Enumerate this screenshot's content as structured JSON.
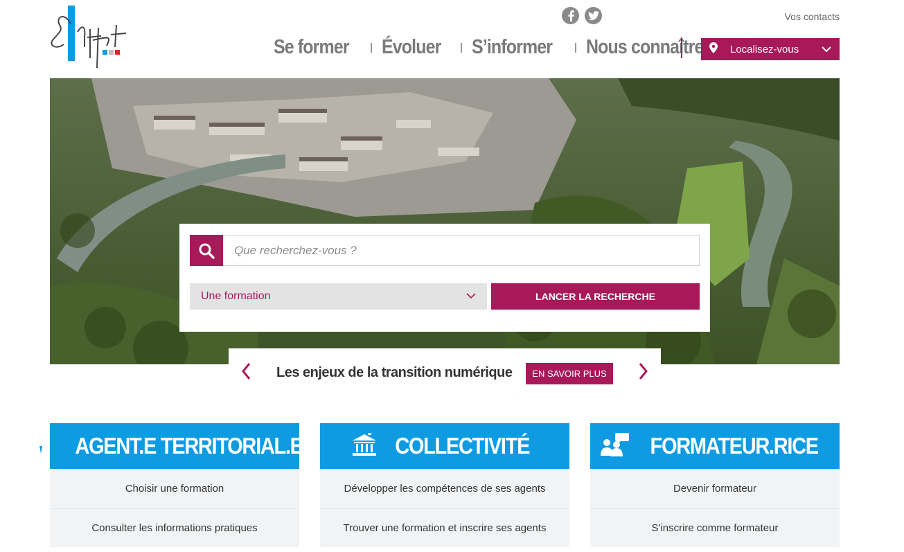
{
  "header": {
    "logo_text": "le Cnfpt",
    "contacts_label": "Vos contacts",
    "social": [
      {
        "icon": "facebook-icon",
        "glyph": "f"
      },
      {
        "icon": "twitter-icon",
        "glyph": "t"
      }
    ],
    "nav": [
      "Se former",
      "Évoluer",
      "S’informer",
      "Nous connaître"
    ],
    "localize_label": "Localisez-vous"
  },
  "search": {
    "placeholder": "Que recherchez-vous ?",
    "select_value": "Une formation",
    "launch_label": "LANCER LA RECHERCHE"
  },
  "slider": {
    "title": "Les enjeux de la transition numérique",
    "more_label": "EN SAVOIR PLUS"
  },
  "cards": [
    {
      "title": "AGENT.E TERRITORIAL.E",
      "icon": "agent-icon",
      "links": [
        "Choisir une formation",
        "Consulter les informations pratiques"
      ]
    },
    {
      "title": "COLLECTIVITÉ",
      "icon": "building-icon",
      "links": [
        "Développer les compétences de ses agents",
        "Trouver une formation et inscrire ses agents"
      ]
    },
    {
      "title": "FORMATEUR.RICE",
      "icon": "trainer-icon",
      "links": [
        "Devenir formateur",
        "S'inscrire comme formateur"
      ]
    }
  ],
  "colors": {
    "brand": "#a8195a",
    "blue": "#0f9be2",
    "nav_gray": "#7a7a7a"
  }
}
